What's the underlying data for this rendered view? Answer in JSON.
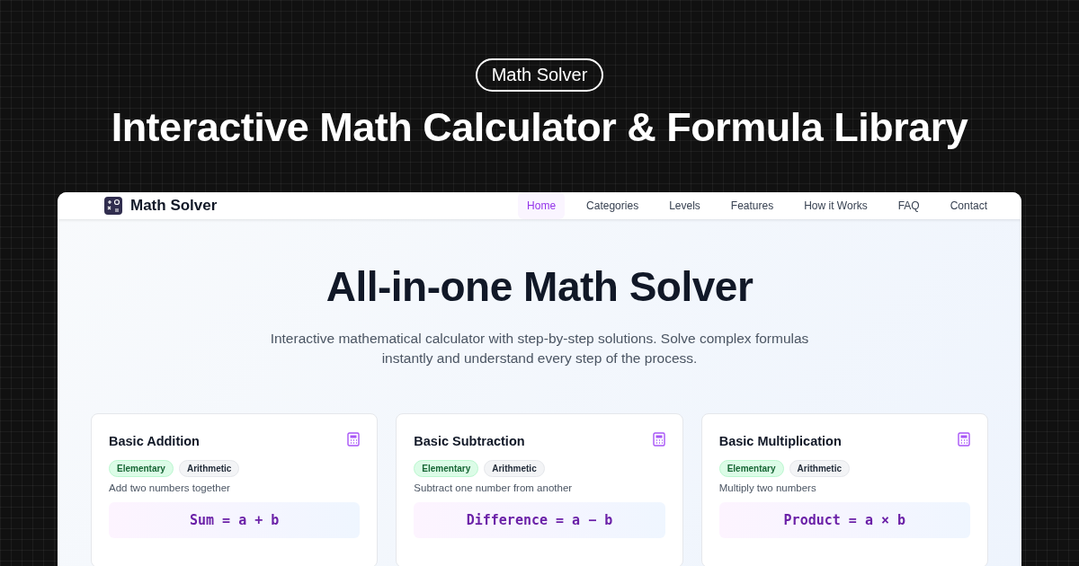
{
  "banner": {
    "badge": "Math Solver",
    "headline": "Interactive Math Calculator & Formula Library"
  },
  "nav": {
    "brand": "Math Solver",
    "links": [
      {
        "label": "Home",
        "selected": true
      },
      {
        "label": "Categories",
        "selected": false
      },
      {
        "label": "Levels",
        "selected": false
      },
      {
        "label": "Features",
        "selected": false
      },
      {
        "label": "How it Works",
        "selected": false
      },
      {
        "label": "FAQ",
        "selected": false
      },
      {
        "label": "Contact",
        "selected": false
      }
    ]
  },
  "hero": {
    "title": "All-in-one Math Solver",
    "subtitle": "Interactive mathematical calculator with step-by-step solutions. Solve complex formulas instantly and understand every step of the process."
  },
  "cards": [
    {
      "title": "Basic Addition",
      "tags": [
        {
          "label": "Elementary",
          "kind": "level"
        },
        {
          "label": "Arithmetic",
          "kind": "category"
        }
      ],
      "description": "Add two numbers together",
      "formula": "Sum = a + b"
    },
    {
      "title": "Basic Subtraction",
      "tags": [
        {
          "label": "Elementary",
          "kind": "level"
        },
        {
          "label": "Arithmetic",
          "kind": "category"
        }
      ],
      "description": "Subtract one number from another",
      "formula": "Difference = a − b"
    },
    {
      "title": "Basic Multiplication",
      "tags": [
        {
          "label": "Elementary",
          "kind": "level"
        },
        {
          "label": "Arithmetic",
          "kind": "category"
        }
      ],
      "description": "Multiply two numbers",
      "formula": "Product = a × b"
    }
  ]
}
